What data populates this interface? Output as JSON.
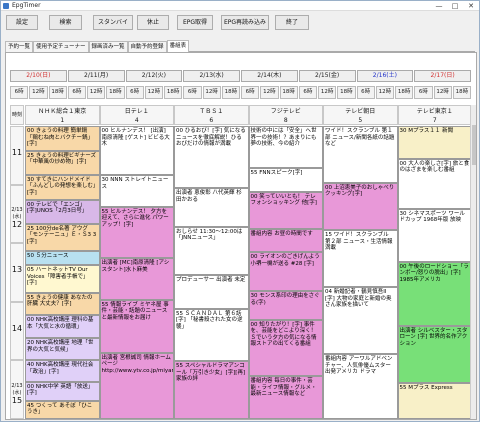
{
  "window": {
    "title": "EpgTimer",
    "min": "—",
    "max": "□",
    "close": "✕"
  },
  "toolbar": {
    "buttons": [
      "設定",
      "検索",
      "スタンバイ",
      "休止",
      "EPG取得",
      "EPG再読み込み",
      "終了"
    ]
  },
  "tabs": [
    "予約一覧",
    "使用予定チューナー",
    "録画済み一覧",
    "自動予約登録",
    "番組表"
  ],
  "active_tab": 4,
  "dates": [
    {
      "label": "2/10(日)",
      "color": "#d23030"
    },
    {
      "label": "2/11(月)",
      "color": "#222222"
    },
    {
      "label": "2/12(火)",
      "color": "#222222"
    },
    {
      "label": "2/13(水)",
      "color": "#222222"
    },
    {
      "label": "2/14(木)",
      "color": "#222222"
    },
    {
      "label": "2/15(金)",
      "color": "#222222"
    },
    {
      "label": "2/16(土)",
      "color": "#2030c8"
    },
    {
      "label": "2/17(日)",
      "color": "#d23030"
    }
  ],
  "hours": [
    "6時",
    "12時",
    "18時",
    "6時",
    "12時",
    "18時",
    "6時",
    "12時",
    "18時",
    "6時",
    "12時",
    "18時",
    "6時",
    "12時",
    "18時",
    "6時",
    "12時",
    "18時",
    "6時",
    "12時",
    "18時",
    "6時",
    "12時",
    "18時"
  ],
  "corner_label": "時刻",
  "times": [
    {
      "h": "11",
      "d": ""
    },
    {
      "h": "12",
      "d": "2/13\n(水)"
    },
    {
      "h": "13",
      "d": ""
    },
    {
      "h": "14",
      "d": ""
    },
    {
      "h": "15",
      "d": "2/13\n(水)"
    }
  ],
  "channels": [
    {
      "name": "ＮＨＫ総合１東京",
      "num": "1"
    },
    {
      "name": "日テレ１",
      "num": "4"
    },
    {
      "name": "ＴＢＳ１",
      "num": "6"
    },
    {
      "name": "フジテレビ",
      "num": "8"
    },
    {
      "name": "テレビ朝日",
      "num": "5"
    },
    {
      "name": "テレビ東京１",
      "num": "7"
    }
  ],
  "programs": [
    [
      {
        "t": "00 きょうの料理 簡単鍋「鶏むね肉とバクチー鍋」[字]",
        "c": "#f8d8a8"
      },
      {
        "t": "25 きょうの料理ビギナーズ「中華風の炒め物」[字]",
        "c": "#f8d8a8"
      },
      {
        "t": "30 すてきにハンドメイド「ふんどしの発想を楽しむ」[字]",
        "c": "#f8d8a8"
      },
      {
        "t": "00 テレビで「エンゴ」[字]UNOS「2月3日号」",
        "c": "#d8b8e8"
      },
      {
        "t": "25 100分de名著 アウグ「モンテーニュ」Ｅ・Ｓ3 3 [字]",
        "c": "#f8d8a8"
      },
      {
        "t": "50 ５分ニュース",
        "c": "#b8e0f0"
      },
      {
        "t": "05 ハートネットTV Our Voices「障害者手帳で」[字]",
        "c": "#fff8d0"
      },
      {
        "t": "55 きょうの健康 あなたの肝臓 大丈夫？[字]",
        "c": "#f8d8a8"
      },
      {
        "t": "00 NHK高校講座 理科の基本「大気と水の循環」",
        "c": "#e0d0f8"
      },
      {
        "t": "20 NHK高校講座 地理「世界の大気と気候」",
        "c": "#e0d0f8"
      },
      {
        "t": "40 NHK高校講座 現代社会「政治」[字]",
        "c": "#e0d0f8"
      },
      {
        "t": "00 NHK中学 英語「放送」[字]",
        "c": "#e0d0f8"
      },
      {
        "t": "45 つくって あそぼ「ひこうき」",
        "c": "#f8d8a8"
      }
    ],
    [
      {
        "t": "00 ヒルナンデス！ [出演] 南原清隆 [ゲスト] ビビる大木",
        "c": "#ffffff"
      },
      {
        "t": "30 NNN ストレイトニュース",
        "c": "#ffffff"
      },
      {
        "t": "55 ヒルナンデス！ 夕方を迎えて、さらに進化 パワーアップ！[字]",
        "c": "#e898d8"
      },
      {
        "t": "出演者 [MC]南原清隆 [アシスタント]水卜麻美",
        "c": "#e898d8"
      },
      {
        "t": "55 情報ライブ ミヤネ屋 事件・芸能・話題のニュースと最新情報をお届け",
        "c": "#e898d8"
      },
      {
        "t": "出演者 宮根誠司 情報ホームページ http://www.ytv.co.jp/miyaneya/",
        "c": "#e898d8"
      }
    ],
    [
      {
        "t": "00 ひるおび！[字] 気になるニュースを徹底解説！ひるおびだけの情報が満載",
        "c": "#ffffff"
      },
      {
        "t": "出演者 恵俊彰 八代英輝 杉田かおる",
        "c": "#ffffff"
      },
      {
        "t": "おしらせ 11:30〜12:00は「JNNニュース」",
        "c": "#ffffff"
      },
      {
        "t": "プロデューサー 出演者 未定",
        "c": "#ffffff"
      },
      {
        "t": "55 ＳＣＡＮＤＡＬ 第６話[字] 「秘書殺された女の逆襲」",
        "c": "#ffffff"
      },
      {
        "t": "55 スペシャルドラマアンコール「万引き少女」[字][再] 家族の絆",
        "c": "#e898d8"
      }
    ],
    [
      {
        "t": "技術の中には「安全」へ世界一の技術！？あまりにも夢の技術、今の紹介",
        "c": "#ffffff"
      },
      {
        "t": "55 FNNスピーク[字]",
        "c": "#ffffff"
      },
      {
        "t": "00 笑っていいとも！ テレフォンショッキング 他[字]",
        "c": "#e898d8"
      },
      {
        "t": "番組内容 お昼の時間です",
        "c": "#e898d8"
      },
      {
        "t": "00 ライオンのごきげんよう 小堺一機が送る #28 [字]",
        "c": "#e898d8"
      },
      {
        "t": "30 モンス系印の理由をさぐる(字)",
        "c": "#e898d8"
      },
      {
        "t": "00 知りたがり！[字] 事件を、芸能をどこより深く！Ｓでいう夕方の気になる情報ストアの出てくる番組",
        "c": "#e898d8"
      },
      {
        "t": "番組内容 毎日の事件・芸能・ライフ情報・グルメ・最新ニュース情報など",
        "c": "#e898d8"
      }
    ],
    [
      {
        "t": "ワイド！スクランブル 第１部 ニュース/新聞各紙の話題など",
        "c": "#ffffff"
      },
      {
        "t": "00 上沼恵美子のおしゃべりクッキング[字]",
        "c": "#e898d8"
      },
      {
        "t": "15 ワイド！スクランブル 第２部 ニュース・生活情報満載",
        "c": "#ffffff"
      },
      {
        "t": "04 新婚記者・鶴見慎吾II [字] 大物の家庭と新婚の奥さん家族を描いて",
        "c": "#ffffff"
      },
      {
        "t": "番組内容 アーワルアドベンチャー、人気俳優ムスター出発アメリカ ドラマ",
        "c": "#ffffff"
      }
    ],
    [
      {
        "t": "30 Mプラス１１ 新聞",
        "c": "#f8f0c8"
      },
      {
        "t": "00 大人の楽しさ[字] 旅と食のはざまを楽しむ番組",
        "c": "#ffffff"
      },
      {
        "t": "30 シネマスポーツ ワールドカップ 1968年版 放映",
        "c": "#ffffff"
      },
      {
        "t": "00 午後のロードショー「ランボー/怒りの脱出」[字] 1985年アメリカ",
        "c": "#78e078"
      },
      {
        "t": "出演者 シルベスター・スタローン [字] 世界的名作アクション",
        "c": "#78e078"
      },
      {
        "t": "55 Mプラス Express",
        "c": "#f8f0c8"
      }
    ]
  ]
}
